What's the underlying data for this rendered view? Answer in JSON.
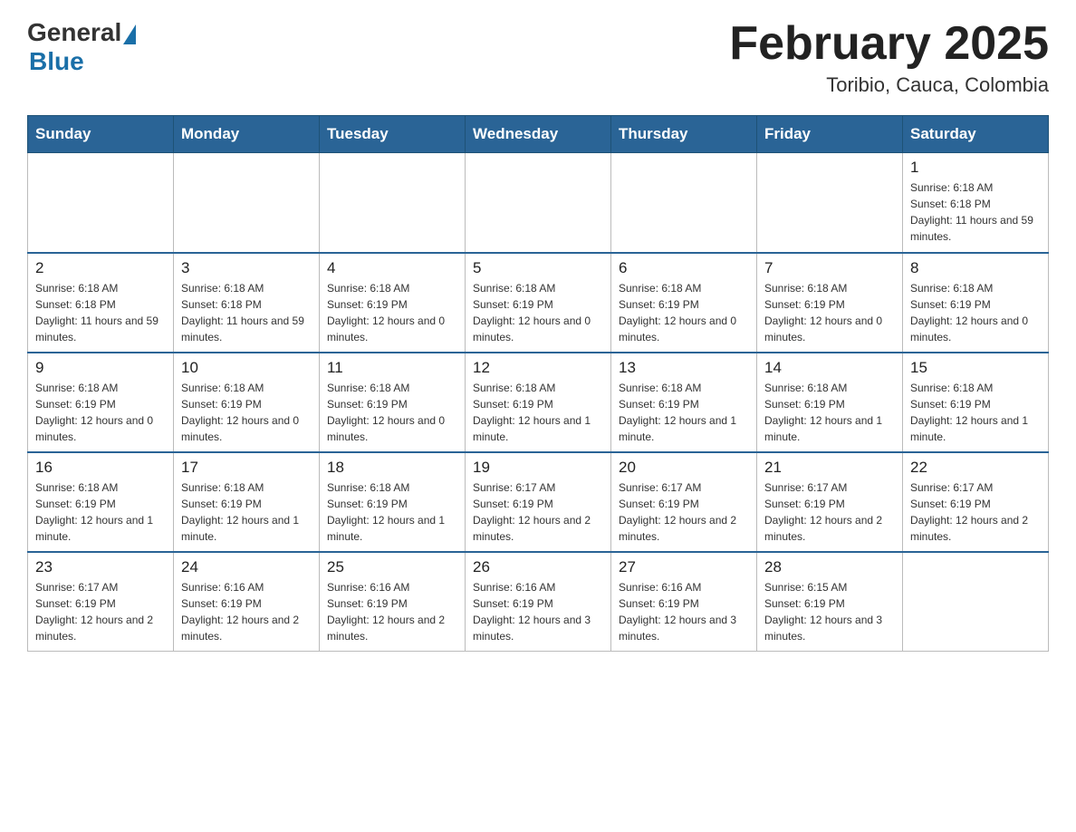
{
  "logo": {
    "text_general": "General",
    "text_blue": "Blue"
  },
  "calendar": {
    "title": "February 2025",
    "subtitle": "Toribio, Cauca, Colombia",
    "days_of_week": [
      "Sunday",
      "Monday",
      "Tuesday",
      "Wednesday",
      "Thursday",
      "Friday",
      "Saturday"
    ],
    "weeks": [
      [
        {
          "day": "",
          "info": ""
        },
        {
          "day": "",
          "info": ""
        },
        {
          "day": "",
          "info": ""
        },
        {
          "day": "",
          "info": ""
        },
        {
          "day": "",
          "info": ""
        },
        {
          "day": "",
          "info": ""
        },
        {
          "day": "1",
          "info": "Sunrise: 6:18 AM\nSunset: 6:18 PM\nDaylight: 11 hours and 59 minutes."
        }
      ],
      [
        {
          "day": "2",
          "info": "Sunrise: 6:18 AM\nSunset: 6:18 PM\nDaylight: 11 hours and 59 minutes."
        },
        {
          "day": "3",
          "info": "Sunrise: 6:18 AM\nSunset: 6:18 PM\nDaylight: 11 hours and 59 minutes."
        },
        {
          "day": "4",
          "info": "Sunrise: 6:18 AM\nSunset: 6:19 PM\nDaylight: 12 hours and 0 minutes."
        },
        {
          "day": "5",
          "info": "Sunrise: 6:18 AM\nSunset: 6:19 PM\nDaylight: 12 hours and 0 minutes."
        },
        {
          "day": "6",
          "info": "Sunrise: 6:18 AM\nSunset: 6:19 PM\nDaylight: 12 hours and 0 minutes."
        },
        {
          "day": "7",
          "info": "Sunrise: 6:18 AM\nSunset: 6:19 PM\nDaylight: 12 hours and 0 minutes."
        },
        {
          "day": "8",
          "info": "Sunrise: 6:18 AM\nSunset: 6:19 PM\nDaylight: 12 hours and 0 minutes."
        }
      ],
      [
        {
          "day": "9",
          "info": "Sunrise: 6:18 AM\nSunset: 6:19 PM\nDaylight: 12 hours and 0 minutes."
        },
        {
          "day": "10",
          "info": "Sunrise: 6:18 AM\nSunset: 6:19 PM\nDaylight: 12 hours and 0 minutes."
        },
        {
          "day": "11",
          "info": "Sunrise: 6:18 AM\nSunset: 6:19 PM\nDaylight: 12 hours and 0 minutes."
        },
        {
          "day": "12",
          "info": "Sunrise: 6:18 AM\nSunset: 6:19 PM\nDaylight: 12 hours and 1 minute."
        },
        {
          "day": "13",
          "info": "Sunrise: 6:18 AM\nSunset: 6:19 PM\nDaylight: 12 hours and 1 minute."
        },
        {
          "day": "14",
          "info": "Sunrise: 6:18 AM\nSunset: 6:19 PM\nDaylight: 12 hours and 1 minute."
        },
        {
          "day": "15",
          "info": "Sunrise: 6:18 AM\nSunset: 6:19 PM\nDaylight: 12 hours and 1 minute."
        }
      ],
      [
        {
          "day": "16",
          "info": "Sunrise: 6:18 AM\nSunset: 6:19 PM\nDaylight: 12 hours and 1 minute."
        },
        {
          "day": "17",
          "info": "Sunrise: 6:18 AM\nSunset: 6:19 PM\nDaylight: 12 hours and 1 minute."
        },
        {
          "day": "18",
          "info": "Sunrise: 6:18 AM\nSunset: 6:19 PM\nDaylight: 12 hours and 1 minute."
        },
        {
          "day": "19",
          "info": "Sunrise: 6:17 AM\nSunset: 6:19 PM\nDaylight: 12 hours and 2 minutes."
        },
        {
          "day": "20",
          "info": "Sunrise: 6:17 AM\nSunset: 6:19 PM\nDaylight: 12 hours and 2 minutes."
        },
        {
          "day": "21",
          "info": "Sunrise: 6:17 AM\nSunset: 6:19 PM\nDaylight: 12 hours and 2 minutes."
        },
        {
          "day": "22",
          "info": "Sunrise: 6:17 AM\nSunset: 6:19 PM\nDaylight: 12 hours and 2 minutes."
        }
      ],
      [
        {
          "day": "23",
          "info": "Sunrise: 6:17 AM\nSunset: 6:19 PM\nDaylight: 12 hours and 2 minutes."
        },
        {
          "day": "24",
          "info": "Sunrise: 6:16 AM\nSunset: 6:19 PM\nDaylight: 12 hours and 2 minutes."
        },
        {
          "day": "25",
          "info": "Sunrise: 6:16 AM\nSunset: 6:19 PM\nDaylight: 12 hours and 2 minutes."
        },
        {
          "day": "26",
          "info": "Sunrise: 6:16 AM\nSunset: 6:19 PM\nDaylight: 12 hours and 3 minutes."
        },
        {
          "day": "27",
          "info": "Sunrise: 6:16 AM\nSunset: 6:19 PM\nDaylight: 12 hours and 3 minutes."
        },
        {
          "day": "28",
          "info": "Sunrise: 6:15 AM\nSunset: 6:19 PM\nDaylight: 12 hours and 3 minutes."
        },
        {
          "day": "",
          "info": ""
        }
      ]
    ]
  }
}
